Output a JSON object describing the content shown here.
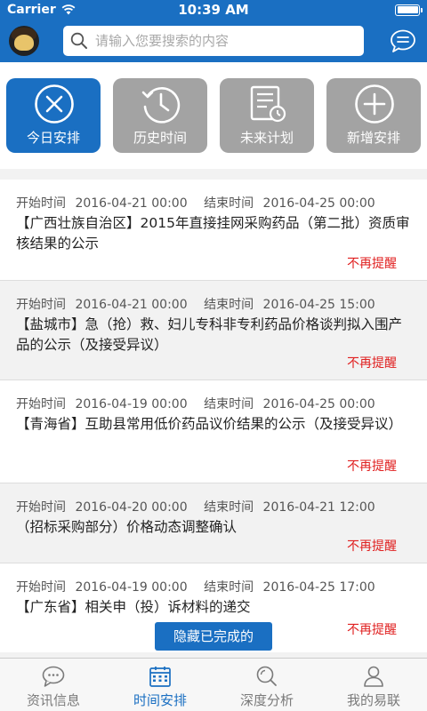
{
  "status_bar": {
    "carrier": "Carrier",
    "time": "10:39 AM"
  },
  "search": {
    "placeholder": "请输入您要搜索的内容"
  },
  "tiles": [
    {
      "label": "今日安排",
      "icon": "close-circle-icon",
      "active": true
    },
    {
      "label": "历史时间",
      "icon": "history-clock-icon",
      "active": false
    },
    {
      "label": "未来计划",
      "icon": "plan-document-icon",
      "active": false
    },
    {
      "label": "新增安排",
      "icon": "add-circle-icon",
      "active": false
    }
  ],
  "list": {
    "start_label": "开始时间",
    "end_label": "结束时间",
    "remind_label": "不再提醒",
    "items": [
      {
        "start": "2016-04-21 00:00",
        "end": "2016-04-25 00:00",
        "title": "【广西壮族自治区】2015年直接挂网采购药品（第二批）资质审核结果的公示"
      },
      {
        "start": "2016-04-21 00:00",
        "end": "2016-04-25 15:00",
        "title": "【盐城市】急（抢）救、妇儿专科非专利药品价格谈判拟入围产品的公示（及接受异议）"
      },
      {
        "start": "2016-04-19 00:00",
        "end": "2016-04-25 00:00",
        "title": "【青海省】互助县常用低价药品议价结果的公示（及接受异议）"
      },
      {
        "start": "2016-04-20 00:00",
        "end": "2016-04-21 12:00",
        "title": "（招标采购部分）价格动态调整确认"
      },
      {
        "start": "2016-04-19 00:00",
        "end": "2016-04-25 17:00",
        "title": "【广东省】相关申（投）诉材料的递交"
      }
    ]
  },
  "hide_completed_label": "隐藏已完成的",
  "tabbar": [
    {
      "label": "资讯信息",
      "icon": "chat-bubble-icon",
      "active": false
    },
    {
      "label": "时间安排",
      "icon": "calendar-icon",
      "active": true
    },
    {
      "label": "深度分析",
      "icon": "search-analysis-icon",
      "active": false
    },
    {
      "label": "我的易联",
      "icon": "user-icon",
      "active": false
    }
  ],
  "colors": {
    "primary": "#1a6fc2",
    "inactive_tile": "#a3a3a3",
    "remind": "#e02020"
  }
}
